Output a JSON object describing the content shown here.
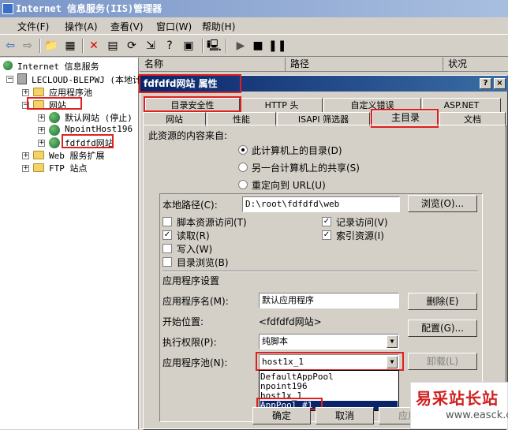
{
  "window": {
    "title": "Internet 信息服务(IIS)管理器"
  },
  "menu": [
    {
      "label": "文件(F)"
    },
    {
      "label": "操作(A)"
    },
    {
      "label": "查看(V)"
    },
    {
      "label": "窗口(W)"
    },
    {
      "label": "帮助(H)"
    }
  ],
  "tree": {
    "root": "Internet 信息服务",
    "server": "LECLOUD-BLEPWJ (本地计",
    "app_pools": "应用程序池",
    "websites": "网站",
    "default_site": "默认网站 (停止)",
    "npoint_site": "NpointHost196",
    "fdfdfd_site": "fdfdfd网站",
    "web_ext": "Web 服务扩展",
    "ftp": "FTP 站点"
  },
  "list_columns": [
    "名称",
    "路径",
    "状况"
  ],
  "dialog": {
    "title": "fdfdfd网站 属性",
    "help_btn": "?",
    "close_btn": "×",
    "tabs_row1": [
      "目录安全性",
      "HTTP 头",
      "自定义错误",
      "ASP.NET"
    ],
    "tabs_row2": [
      "网站",
      "性能",
      "ISAPI 筛选器",
      "主目录",
      "文档"
    ],
    "content_source_label": "此资源的内容来自:",
    "radio_local": "此计算机上的目录(D)",
    "radio_share": "另一台计算机上的共享(S)",
    "radio_redirect": "重定向到 URL(U)",
    "local_path_label": "本地路径(C):",
    "local_path_value": "D:\\root\\fdfdfd\\web",
    "browse_btn": "浏览(O)...",
    "chk_script_source": "脚本资源访问(T)",
    "chk_read": "读取(R)",
    "chk_write": "写入(W)",
    "chk_dir_browse": "目录浏览(B)",
    "chk_log": "记录访问(V)",
    "chk_index": "索引资源(I)",
    "app_settings_label": "应用程序设置",
    "app_name_label": "应用程序名(M):",
    "app_name_value": "默认应用程序",
    "remove_btn": "删除(E)",
    "start_point_label": "开始位置:",
    "start_point_value": "<fdfdfd网站>",
    "config_btn": "配置(G)...",
    "exec_perm_label": "执行权限(P):",
    "exec_perm_value": "纯脚本",
    "app_pool_label": "应用程序池(N):",
    "app_pool_value": "host1x_1",
    "unload_btn": "卸载(L)",
    "pool_options": [
      "DefaultAppPool",
      "npoint196",
      "host1x_1",
      "AppPool #1"
    ],
    "ok_btn": "确定",
    "cancel_btn": "取消",
    "apply_btn": "应用"
  },
  "watermark": {
    "text": "易采站长站",
    "url": "www.easck.com"
  },
  "state": {
    "radio_local": true,
    "chk_script_source": false,
    "chk_read": true,
    "chk_write": false,
    "chk_dir_browse": false,
    "chk_log": true,
    "chk_index": true,
    "selected_pool_index": 3
  }
}
